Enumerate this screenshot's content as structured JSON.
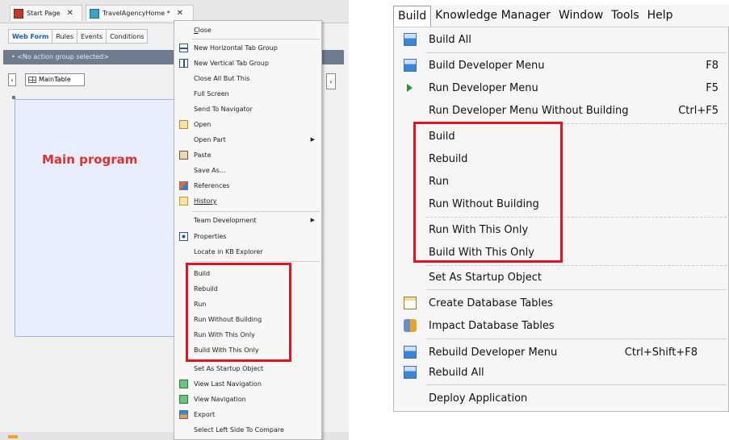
{
  "left_window": {
    "tabs": [
      {
        "label": "Start Page",
        "close": "✕"
      },
      {
        "label": "TravelAgencyHome *",
        "close": "✕"
      }
    ],
    "subtabs": [
      "Web Form",
      "Rules",
      "Events",
      "Conditions"
    ],
    "action_group": "• <No action group selected>",
    "maintable": "MainTable",
    "canvas_text": "Main program",
    "context_menu": {
      "items": [
        {
          "label": "Close",
          "u": "C",
          "rest": "lose"
        },
        {
          "label": "New Horizontal Tab Group"
        },
        {
          "label": "New Vertical Tab Group"
        },
        {
          "label": "Close All But This"
        },
        {
          "label": "Full Screen"
        },
        {
          "label": "Send To Navigator"
        },
        {
          "label": "Open"
        },
        {
          "label": "Open Part"
        },
        {
          "label": "Paste"
        },
        {
          "label": "Save As..."
        },
        {
          "label": "References"
        },
        {
          "label": "History"
        },
        {
          "label": "Team Development"
        },
        {
          "label": "Properties"
        },
        {
          "label": "Locate in KB Explorer"
        },
        {
          "label": "Build"
        },
        {
          "label": "Rebuild"
        },
        {
          "label": "Run"
        },
        {
          "label": "Run Without Building"
        },
        {
          "label": "Run With This Only"
        },
        {
          "label": "Build With This Only"
        },
        {
          "label": "Set As Startup Object"
        },
        {
          "label": "View Last Navigation"
        },
        {
          "label": "View Navigation"
        },
        {
          "label": "Export"
        },
        {
          "label": "Select Left Side To Compare"
        }
      ]
    }
  },
  "right_window": {
    "menubar": [
      "Build",
      "Knowledge Manager",
      "Window",
      "Tools",
      "Help"
    ],
    "items": [
      {
        "label": "Build All",
        "shortcut": ""
      },
      {
        "label": "Build Developer Menu",
        "shortcut": "F8"
      },
      {
        "label": "Run Developer Menu",
        "shortcut": "F5"
      },
      {
        "label": "Run Developer Menu Without Building",
        "shortcut": "Ctrl+F5"
      },
      {
        "label": "Build",
        "shortcut": ""
      },
      {
        "label": "Rebuild",
        "shortcut": ""
      },
      {
        "label": "Run",
        "shortcut": ""
      },
      {
        "label": "Run Without Building",
        "shortcut": ""
      },
      {
        "label": "Run With This Only",
        "shortcut": ""
      },
      {
        "label": "Build With This Only",
        "shortcut": ""
      },
      {
        "label": "Set As Startup Object",
        "shortcut": ""
      },
      {
        "label": "Create Database Tables",
        "shortcut": ""
      },
      {
        "label": "Impact Database Tables",
        "shortcut": ""
      },
      {
        "label": "Rebuild Developer Menu",
        "shortcut": "Ctrl+Shift+F8"
      },
      {
        "label": "Rebuild All",
        "shortcut": ""
      },
      {
        "label": "Deploy Application",
        "shortcut": ""
      }
    ]
  },
  "colors": {
    "highlight": "#e0141e",
    "canvas": "#e8eefe",
    "main_program": "#e03030"
  }
}
